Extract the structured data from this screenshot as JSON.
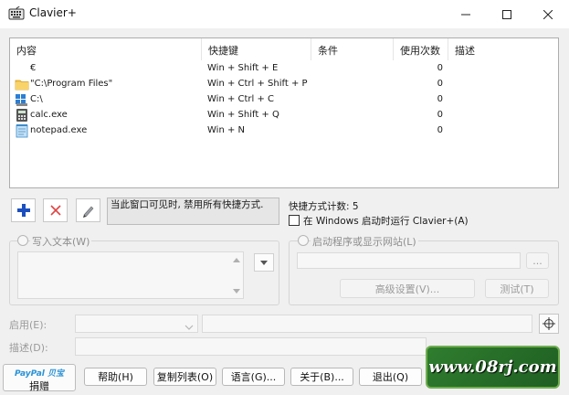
{
  "window": {
    "title": "Clavier+"
  },
  "list": {
    "columns": [
      "内容",
      "快捷键",
      "条件",
      "使用次数",
      "描述"
    ],
    "rows": [
      {
        "content": "€",
        "shortcut": "Win + Shift + E",
        "condition": "",
        "uses": "0",
        "description": "",
        "icon": "none"
      },
      {
        "content": "\"C:\\Program Files\"",
        "shortcut": "Win + Ctrl + Shift + P",
        "condition": "",
        "uses": "0",
        "description": "",
        "icon": "folder-icon"
      },
      {
        "content": "C:\\",
        "shortcut": "Win + Ctrl + C",
        "condition": "",
        "uses": "0",
        "description": "",
        "icon": "drive-icon"
      },
      {
        "content": "calc.exe",
        "shortcut": "Win + Shift + Q",
        "condition": "",
        "uses": "0",
        "description": "",
        "icon": "calculator-icon"
      },
      {
        "content": "notepad.exe",
        "shortcut": "Win + N",
        "condition": "",
        "uses": "0",
        "description": "",
        "icon": "notepad-icon"
      }
    ]
  },
  "status": {
    "message": "当此窗口可见时, 禁用所有快捷方式.",
    "count_label": "快捷方式计数:  5",
    "startup_label": "在 Windows 启动时运行 Clavier+(A)",
    "startup_checked": false
  },
  "text_group": {
    "label": "写入文本(W)"
  },
  "program_group": {
    "label": "启动程序或显示网站(L)",
    "browse": "...",
    "advanced": "高级设置(V)...",
    "test": "测试(T)"
  },
  "fields": {
    "enable_label": "启用(E):",
    "description_label": "描述(D):"
  },
  "buttons": {
    "paypal_logo_1": "PayPal",
    "paypal_logo_2": " 贝宝",
    "donate": "捐赠",
    "help": "帮助(H)",
    "copy_list": "复制列表(O)",
    "language": "语言(G)...",
    "about": "关于(B)...",
    "exit": "退出(Q)"
  },
  "watermark": {
    "text": "www.08rj.com"
  },
  "colors": {
    "add": "#1b4fbf",
    "delete": "#e04545",
    "accent_watermark": "#2f7d2f"
  }
}
